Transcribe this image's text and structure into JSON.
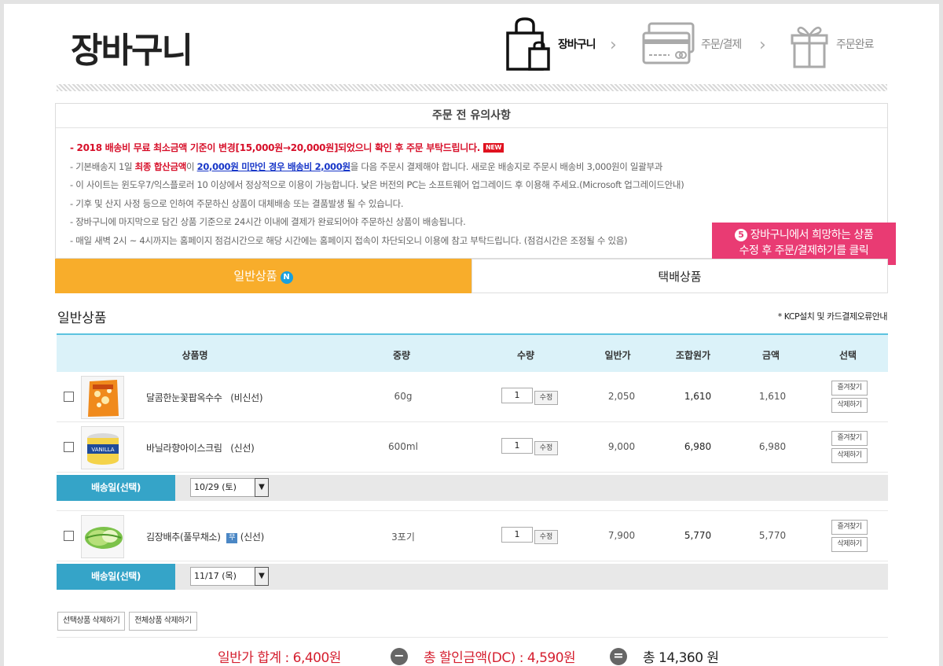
{
  "header": {
    "title": "장바구니",
    "steps": [
      {
        "label": "장바구니",
        "icon": "shopping-bag-icon",
        "active": true
      },
      {
        "label": "주문/결제",
        "icon": "credit-card-icon",
        "active": false
      },
      {
        "label": "주문완료",
        "icon": "gift-box-icon",
        "active": false
      }
    ]
  },
  "notice": {
    "title": "주문 전 유의사항",
    "hot_line": "- 2018 배송비 무료 최소금액 기준이 변경[15,000원→20,000원]되었으니 확인 후 주문 부탁드립니다.",
    "new_badge": "NEW",
    "line2_a": "- 기본배송지 1일 ",
    "line2_b": "최종 합산금액",
    "line2_c": "이 ",
    "line2_d": "20,000원 미만인 경우 배송비 2,000원",
    "line2_e": "을 다음 주문시 결제해야 합니다. 새로운 배송지로 주문시 배송비 3,000원이 일괄부과",
    "line3": "- 이 사이트는 윈도우7/익스플로러 10 이상에서 정상적으로 이용이 가능합니다. 낮은 버전의 PC는 소프트웨어 업그레이드 후 이용해 주세요.(Microsoft 업그레이드안내)",
    "line4": "- 기후 및 산지 사정 등으로 인하여 주문하신 상품이 대체배송 또는 결품발생 될 수 있습니다.",
    "line5": "- 장바구니에 마지막으로 담긴 상품 기준으로 24시간 이내에 결제가 완료되어야 주문하신 상품이 배송됩니다.",
    "line6": "- 매일 새벽 2시 ~ 4시까지는 홈페이지 점검시간으로 해당 시간에는 홈페이지 접속이 차단되오니 이용에 참고 부탁드립니다. (점검시간은 조정될 수 있음)"
  },
  "callout": {
    "num": "5",
    "line1": "장바구니에서 희망하는 상품",
    "line2": "수정 후 주문/결제하기를 클릭"
  },
  "tabs": {
    "general": "일반상품",
    "general_badge": "N",
    "parcel": "택배상품"
  },
  "section": {
    "title": "일반상품",
    "kcp_link": "* KCP설치 및 카드결제오류안내"
  },
  "table": {
    "headers": [
      "상품명",
      "중량",
      "수량",
      "일반가",
      "조합원가",
      "금액",
      "선택"
    ],
    "qty_button": "수정",
    "wish_button": "즐겨찾기",
    "delete_button": "삭제하기",
    "ship_label": "배송일(선택)",
    "items": [
      {
        "name": "달콤한눈꽃팝옥수수",
        "type": "(비신선)",
        "weight": "60g",
        "qty": "1",
        "price": "2,050",
        "member_price": "1,610",
        "amount": "1,610"
      },
      {
        "name": "바닐라향아이스크림",
        "type": "(신선)",
        "weight": "600ml",
        "qty": "1",
        "price": "9,000",
        "member_price": "6,980",
        "amount": "6,980"
      },
      {
        "name": "김장배추(풀무채소)",
        "tag": "무",
        "type": "(신선)",
        "weight": "3포기",
        "qty": "1",
        "price": "7,900",
        "member_price": "5,770",
        "amount": "5,770"
      }
    ],
    "ship_dates": [
      "10/29 (토)",
      "11/17 (목)"
    ]
  },
  "actions": {
    "delete_selected": "선택상품 삭제하기",
    "delete_all": "전체상품 삭제하기"
  },
  "totals": {
    "subtotal": "일반가 합계 : 6,400원",
    "discount": "총 할인금액(DC) : 4,590원",
    "total": "총 14,360 원",
    "minus": "−",
    "equals": "="
  },
  "colors": {
    "tab_active": "#f8ad2b",
    "ship_label": "#35a4c8",
    "callout": "#e93b73",
    "notice_red": "#d7102a"
  }
}
